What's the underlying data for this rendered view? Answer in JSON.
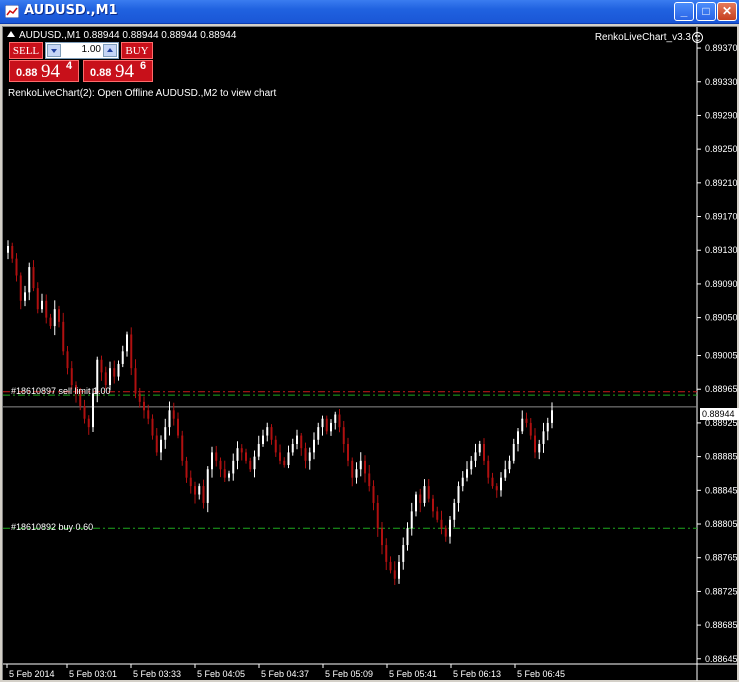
{
  "window": {
    "title": "AUDUSD.,M1",
    "buttons": {
      "minimize": "_",
      "maximize": "□",
      "close": "✕"
    }
  },
  "chart_info": {
    "line": "AUDUSD.,M1  0.88944 0.88944 0.88944 0.88944",
    "indicator_name": "RenkoLiveChart_v3.3",
    "message": "RenkoLiveChart(2): Open Offline AUDUSD.,M2 to view chart"
  },
  "one_click": {
    "sell_label": "SELL",
    "buy_label": "BUY",
    "lot_value": "1.00",
    "sell_price": {
      "small": "0.88",
      "big": "94",
      "sup": "4"
    },
    "buy_price": {
      "small": "0.88",
      "big": "94",
      "sup": "6"
    }
  },
  "orders": {
    "sell_limit_label": "#18610897 sell limit 1.00",
    "buy_label": "#18610892 buy 0.60"
  },
  "current_price": "0.88944",
  "colors": {
    "bull": "#ffffff",
    "bear": "#b01010",
    "sell_limit_line": "#cc1a1a",
    "sell_tp_line": "#1fa81f",
    "buy_line": "#1fa81f",
    "bid_line": "#8c8c8c",
    "accent_title": "#2062e0"
  },
  "chart_data": {
    "type": "candlestick",
    "symbol": "AUDUSD.",
    "timeframe": "M1",
    "y_ticks": [
      "0.89370",
      "0.89330",
      "0.89290",
      "0.89250",
      "0.89210",
      "0.89170",
      "0.89130",
      "0.89090",
      "0.89050",
      "0.89005",
      "0.88965",
      "0.88925",
      "0.88885",
      "0.88845",
      "0.88805",
      "0.88765",
      "0.88725",
      "0.88685",
      "0.88645"
    ],
    "y_tick_values": [
      0.8937,
      0.8933,
      0.8929,
      0.8925,
      0.8921,
      0.8917,
      0.8913,
      0.8909,
      0.8905,
      0.89005,
      0.88965,
      0.88925,
      0.88885,
      0.88845,
      0.88805,
      0.88765,
      0.88725,
      0.88685,
      0.88645
    ],
    "x_ticks": [
      "5 Feb 2014",
      "5 Feb 03:01",
      "5 Feb 03:33",
      "5 Feb 04:05",
      "5 Feb 04:37",
      "5 Feb 05:09",
      "5 Feb 05:41",
      "5 Feb 06:13",
      "5 Feb 06:45"
    ],
    "ylim": [
      0.8864,
      0.89395
    ],
    "levels": {
      "sell_limit": 0.88962,
      "sell_tp": 0.88958,
      "bid": 0.88944,
      "buy": 0.888
    },
    "close_path": [
      0.89135,
      0.8912,
      0.891,
      0.8907,
      0.8908,
      0.8911,
      0.89085,
      0.8906,
      0.8907,
      0.8905,
      0.8904,
      0.8906,
      0.89045,
      0.8901,
      0.8899,
      0.8897,
      0.8896,
      0.88945,
      0.8893,
      0.8892,
      0.8896,
      0.89,
      0.88985,
      0.8897,
      0.8899,
      0.8898,
      0.88995,
      0.8901,
      0.8903,
      0.8899,
      0.8896,
      0.8895,
      0.8894,
      0.8893,
      0.8891,
      0.8889,
      0.88905,
      0.8892,
      0.8894,
      0.8893,
      0.8891,
      0.8888,
      0.8886,
      0.8885,
      0.8884,
      0.8885,
      0.8883,
      0.8887,
      0.8889,
      0.8888,
      0.8887,
      0.8886,
      0.88865,
      0.8888,
      0.88895,
      0.8889,
      0.8888,
      0.8887,
      0.88885,
      0.889,
      0.8891,
      0.8892,
      0.88905,
      0.8889,
      0.8888,
      0.88875,
      0.8889,
      0.889,
      0.8891,
      0.88895,
      0.8888,
      0.8889,
      0.88905,
      0.8892,
      0.8893,
      0.88915,
      0.88925,
      0.88935,
      0.8892,
      0.889,
      0.8888,
      0.8886,
      0.8887,
      0.8888,
      0.88865,
      0.8885,
      0.8883,
      0.888,
      0.8878,
      0.8876,
      0.8875,
      0.8874,
      0.8876,
      0.8878,
      0.888,
      0.8882,
      0.8884,
      0.8883,
      0.8885,
      0.88835,
      0.8882,
      0.8881,
      0.888,
      0.8879,
      0.8881,
      0.8883,
      0.8885,
      0.8886,
      0.8887,
      0.8888,
      0.8889,
      0.889,
      0.8888,
      0.8886,
      0.8885,
      0.88845,
      0.8886,
      0.8887,
      0.8888,
      0.889,
      0.88915,
      0.8893,
      0.88925,
      0.8891,
      0.8889,
      0.889,
      0.88915,
      0.88925,
      0.8894
    ]
  }
}
